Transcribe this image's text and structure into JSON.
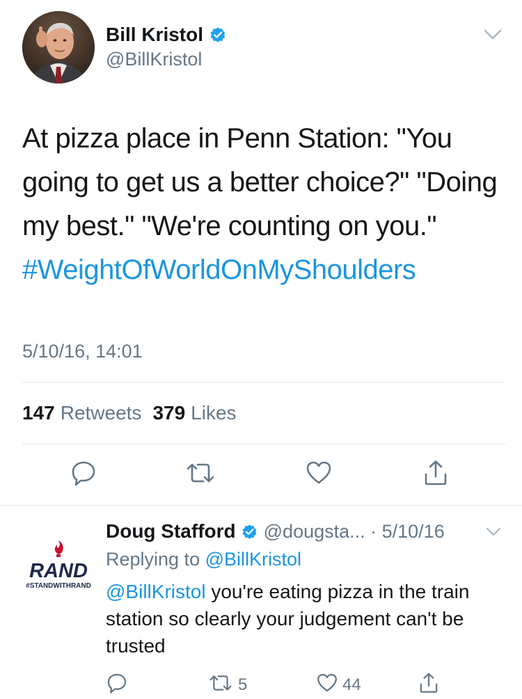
{
  "tweet": {
    "display_name": "Bill Kristol",
    "handle": "@BillKristol",
    "text": "At pizza place in Penn Station: \"You going to get us a better choice?\" \"Doing my best.\" \"We're counting on you.\"",
    "hashtag": "#WeightOfWorldOnMyShoulders",
    "timestamp": "5/10/16, 14:01",
    "retweets_count": "147",
    "retweets_label": "Retweets",
    "likes_count": "379",
    "likes_label": "Likes",
    "verified": true
  },
  "actions_main": [
    "reply-icon",
    "retweet-icon",
    "like-icon",
    "share-icon"
  ],
  "reply": {
    "display_name": "Doug Stafford",
    "handle_date": "@dougsta... · 5/10/16",
    "replying_prefix": "Replying to",
    "replying_to": "@BillKristol",
    "mention": "@BillKristol",
    "text": " you're eating pizza in the train station so clearly your judgement can't be trusted",
    "retweet_count": "5",
    "like_count": "44",
    "avatar_logo_text": "RAND",
    "avatar_logo_subtext": "#STANDWITHRAND"
  },
  "colors": {
    "accent": "#1b95e0",
    "secondary_text": "#657786",
    "primary_text": "#14171a",
    "divider": "#e1e8ed",
    "verified": "#1da1f2",
    "rand_red": "#c8102e",
    "rand_navy": "#1c2a4a"
  }
}
